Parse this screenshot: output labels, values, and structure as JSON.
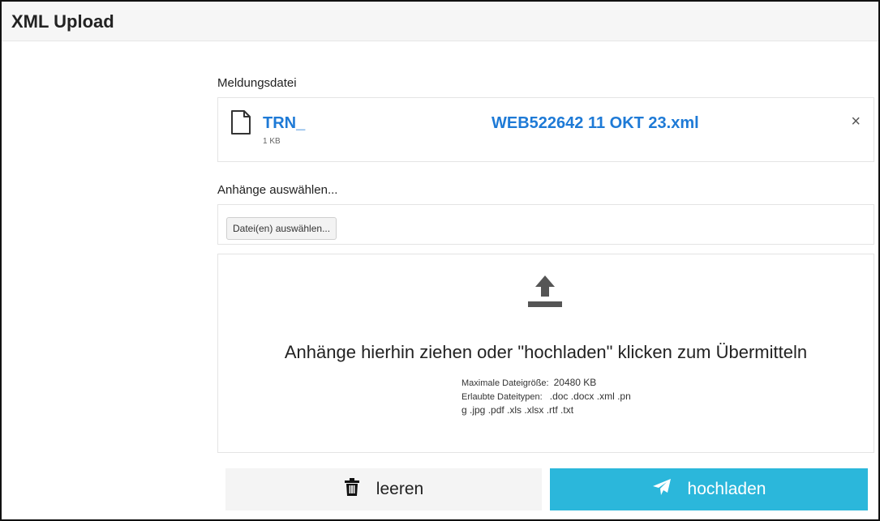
{
  "header": {
    "title": "XML Upload"
  },
  "report_file": {
    "label": "Meldungsdatei",
    "name_part1": "TRN_",
    "name_part2": "WEB522642 11 OKT 23.xml",
    "size": "1 KB",
    "remove_symbol": "×"
  },
  "attachments": {
    "label": "Anhänge auswählen...",
    "select_button": "Datei(en) auswählen...",
    "drop_text": "Anhänge hierhin ziehen oder \"hochladen\" klicken zum Übermitteln",
    "max_size_label": "Maximale Dateigröße:",
    "max_size_value": "20480 KB",
    "allowed_types_label": "Erlaubte Dateitypen:",
    "allowed_types_value": ".doc .docx .xml .png .jpg .pdf .xls .xlsx .rtf .txt"
  },
  "actions": {
    "clear_label": "leeren",
    "upload_label": "hochladen"
  },
  "icons": {
    "file": "file-icon",
    "upload": "upload-icon",
    "trash": "trash-icon",
    "send": "paper-plane-icon"
  },
  "colors": {
    "link_blue": "#1e7ad6",
    "upload_button": "#2bb7db",
    "clear_button": "#f4f4f4"
  }
}
